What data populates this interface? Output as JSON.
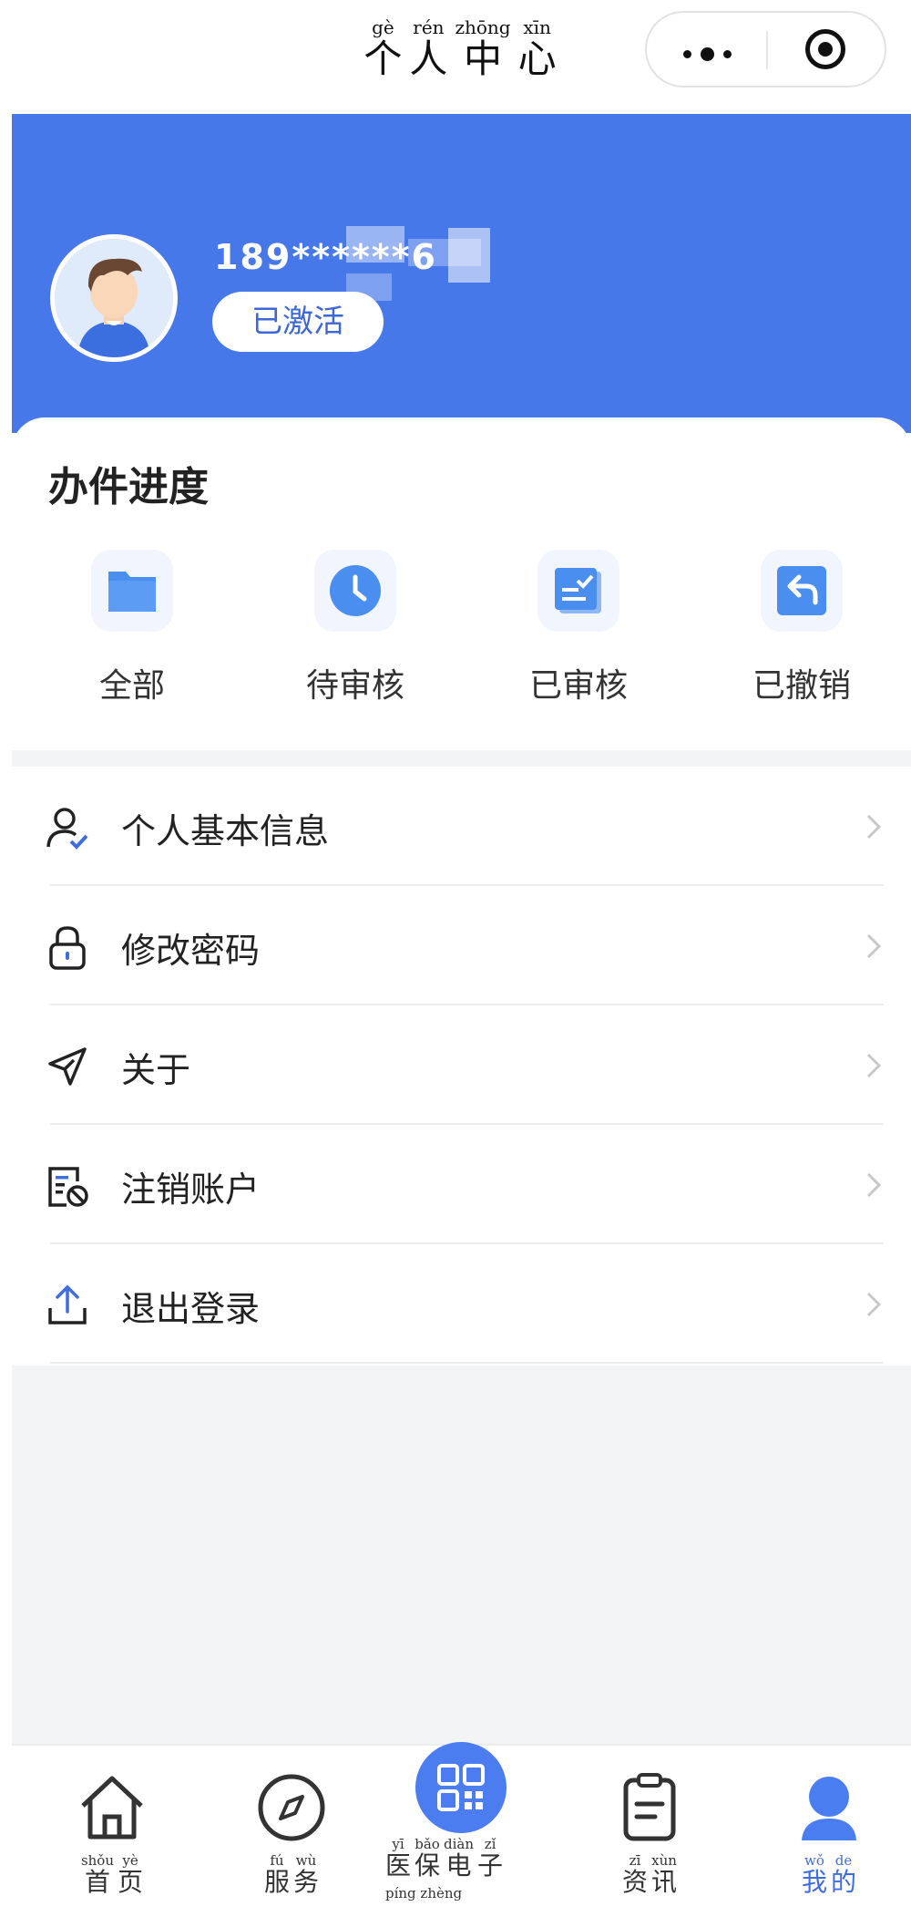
{
  "nav": {
    "title_pinyin": [
      "gè",
      "rén",
      "zhōng",
      "xīn"
    ],
    "title_chars": [
      "个",
      "人",
      "中",
      "心"
    ]
  },
  "profile": {
    "username": "189******6",
    "status": "已激活"
  },
  "progress": {
    "title": "办件进度",
    "items": [
      {
        "label": "全部",
        "icon": "folder-icon"
      },
      {
        "label": "待审核",
        "icon": "clock-icon"
      },
      {
        "label": "已审核",
        "icon": "reviewed-doc-icon"
      },
      {
        "label": "已撤销",
        "icon": "undo-icon"
      }
    ]
  },
  "menu": {
    "items": [
      {
        "label": "个人基本信息",
        "icon": "user-check-icon"
      },
      {
        "label": "修改密码",
        "icon": "lock-icon"
      },
      {
        "label": "关于",
        "icon": "send-arrow-icon"
      },
      {
        "label": "注销账户",
        "icon": "cancel-account-icon"
      },
      {
        "label": "退出登录",
        "icon": "upload-logout-icon"
      }
    ]
  },
  "tabs": {
    "home": {
      "pinyin": [
        "shǒu",
        "yè"
      ],
      "chars": [
        "首",
        "页"
      ]
    },
    "service": {
      "pinyin": [
        "fú",
        "wù"
      ],
      "chars": [
        "服",
        "务"
      ]
    },
    "qr": {
      "pinyin": [
        "yī",
        "bǎo",
        "diàn",
        "zǐ"
      ],
      "chars": [
        "医",
        "保",
        "电",
        "子"
      ],
      "pinyin2": "píng zhèng"
    },
    "news": {
      "pinyin": [
        "zī",
        "xùn"
      ],
      "chars": [
        "资",
        "讯"
      ]
    },
    "mine": {
      "pinyin": [
        "wǒ",
        "de"
      ],
      "chars": [
        "我",
        "的"
      ]
    }
  },
  "colors": {
    "brand_blue": "#4778ea",
    "active_tab": "#3f6ddc",
    "icon_blue": "#4a8ef0"
  }
}
